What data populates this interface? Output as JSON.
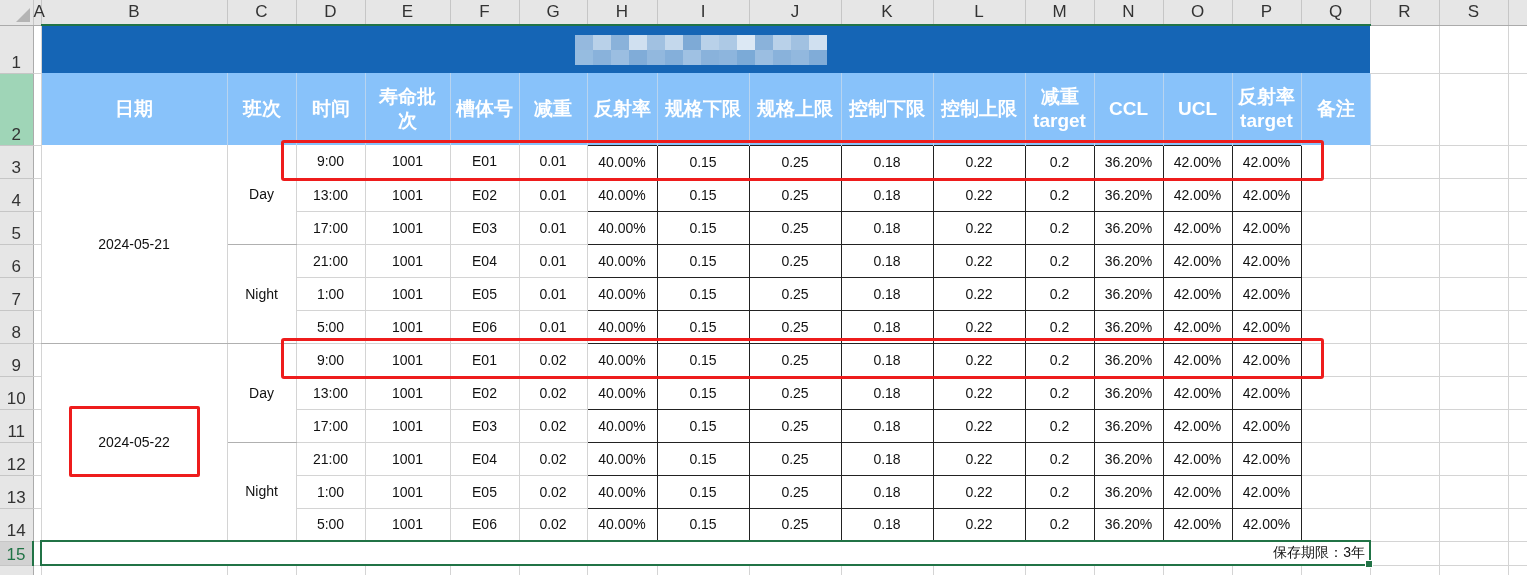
{
  "column_letters": [
    "A",
    "B",
    "C",
    "D",
    "E",
    "F",
    "G",
    "H",
    "I",
    "J",
    "K",
    "L",
    "M",
    "N",
    "O",
    "P",
    "Q",
    "R",
    "S"
  ],
  "row_numbers": [
    {
      "label": "1",
      "highlighted": false,
      "selected": false
    },
    {
      "label": "2",
      "highlighted": true,
      "selected": false
    },
    {
      "label": "3",
      "highlighted": false,
      "selected": false
    },
    {
      "label": "4",
      "highlighted": false,
      "selected": false
    },
    {
      "label": "5",
      "highlighted": false,
      "selected": false
    },
    {
      "label": "6",
      "highlighted": false,
      "selected": false
    },
    {
      "label": "7",
      "highlighted": false,
      "selected": false
    },
    {
      "label": "8",
      "highlighted": false,
      "selected": false
    },
    {
      "label": "9",
      "highlighted": false,
      "selected": false
    },
    {
      "label": "10",
      "highlighted": false,
      "selected": false
    },
    {
      "label": "11",
      "highlighted": false,
      "selected": false
    },
    {
      "label": "12",
      "highlighted": false,
      "selected": false
    },
    {
      "label": "13",
      "highlighted": false,
      "selected": false
    },
    {
      "label": "14",
      "highlighted": false,
      "selected": false
    },
    {
      "label": "15",
      "highlighted": false,
      "selected": true
    }
  ],
  "headers": [
    "日期",
    "班次",
    "时间",
    "寿命批次",
    "槽体号",
    "减重",
    "反射率",
    "规格下限",
    "规格上限",
    "控制下限",
    "控制上限",
    "减重 target",
    "CCL",
    "UCL",
    "反射率 target",
    "备注"
  ],
  "dates": [
    {
      "date": "2024-05-21",
      "highlighted": false,
      "shifts": [
        {
          "name": "Day",
          "rows": [
            {
              "highlighted": true,
              "cells": [
                "9:00",
                "1001",
                "E01",
                "0.01",
                "40.00%",
                "0.15",
                "0.25",
                "0.18",
                "0.22",
                "0.2",
                "36.20%",
                "42.00%",
                "42.00%"
              ]
            },
            {
              "highlighted": false,
              "cells": [
                "13:00",
                "1001",
                "E02",
                "0.01",
                "40.00%",
                "0.15",
                "0.25",
                "0.18",
                "0.22",
                "0.2",
                "36.20%",
                "42.00%",
                "42.00%"
              ]
            },
            {
              "highlighted": false,
              "cells": [
                "17:00",
                "1001",
                "E03",
                "0.01",
                "40.00%",
                "0.15",
                "0.25",
                "0.18",
                "0.22",
                "0.2",
                "36.20%",
                "42.00%",
                "42.00%"
              ]
            }
          ]
        },
        {
          "name": "Night",
          "rows": [
            {
              "highlighted": false,
              "cells": [
                "21:00",
                "1001",
                "E04",
                "0.01",
                "40.00%",
                "0.15",
                "0.25",
                "0.18",
                "0.22",
                "0.2",
                "36.20%",
                "42.00%",
                "42.00%"
              ]
            },
            {
              "highlighted": false,
              "cells": [
                "1:00",
                "1001",
                "E05",
                "0.01",
                "40.00%",
                "0.15",
                "0.25",
                "0.18",
                "0.22",
                "0.2",
                "36.20%",
                "42.00%",
                "42.00%"
              ]
            },
            {
              "highlighted": false,
              "cells": [
                "5:00",
                "1001",
                "E06",
                "0.01",
                "40.00%",
                "0.15",
                "0.25",
                "0.18",
                "0.22",
                "0.2",
                "36.20%",
                "42.00%",
                "42.00%"
              ]
            }
          ]
        }
      ]
    },
    {
      "date": "2024-05-22",
      "highlighted": true,
      "shifts": [
        {
          "name": "Day",
          "rows": [
            {
              "highlighted": true,
              "cells": [
                "9:00",
                "1001",
                "E01",
                "0.02",
                "40.00%",
                "0.15",
                "0.25",
                "0.18",
                "0.22",
                "0.2",
                "36.20%",
                "42.00%",
                "42.00%"
              ]
            },
            {
              "highlighted": false,
              "cells": [
                "13:00",
                "1001",
                "E02",
                "0.02",
                "40.00%",
                "0.15",
                "0.25",
                "0.18",
                "0.22",
                "0.2",
                "36.20%",
                "42.00%",
                "42.00%"
              ]
            },
            {
              "highlighted": false,
              "cells": [
                "17:00",
                "1001",
                "E03",
                "0.02",
                "40.00%",
                "0.15",
                "0.25",
                "0.18",
                "0.22",
                "0.2",
                "36.20%",
                "42.00%",
                "42.00%"
              ]
            }
          ]
        },
        {
          "name": "Night",
          "rows": [
            {
              "highlighted": false,
              "cells": [
                "21:00",
                "1001",
                "E04",
                "0.02",
                "40.00%",
                "0.15",
                "0.25",
                "0.18",
                "0.22",
                "0.2",
                "36.20%",
                "42.00%",
                "42.00%"
              ]
            },
            {
              "highlighted": false,
              "cells": [
                "1:00",
                "1001",
                "E05",
                "0.02",
                "40.00%",
                "0.15",
                "0.25",
                "0.18",
                "0.22",
                "0.2",
                "36.20%",
                "42.00%",
                "42.00%"
              ]
            },
            {
              "highlighted": false,
              "cells": [
                "5:00",
                "1001",
                "E06",
                "0.02",
                "40.00%",
                "0.15",
                "0.25",
                "0.18",
                "0.22",
                "0.2",
                "36.20%",
                "42.00%",
                "42.00%"
              ]
            }
          ]
        }
      ]
    }
  ],
  "footer_note": "保存期限：3年"
}
